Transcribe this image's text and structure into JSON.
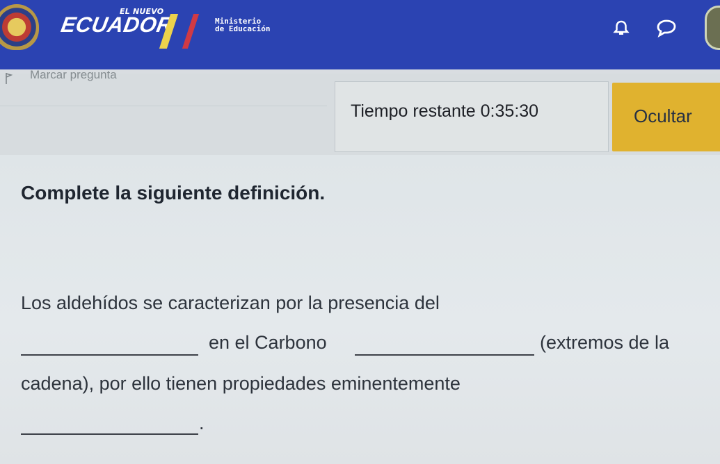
{
  "header": {
    "brand_small": "EL NUEVO",
    "brand_name": "ECUADOR",
    "ministry_line1": "Ministerio",
    "ministry_line2": "de Educación",
    "icons": [
      "crest-icon",
      "bell-icon",
      "chat-icon",
      "avatar"
    ],
    "colors": {
      "bar": "#2b43b2",
      "accent_yellow": "#ecd24c",
      "accent_red": "#d13a44"
    }
  },
  "question_bar": {
    "flag_label": "Marcar pregunta",
    "timer_label": "Tiempo restante 0:35:30",
    "hide_button": "Ocultar"
  },
  "question": {
    "title": "Complete la siguiente definición.",
    "line1": "Los aldehídos se caracterizan por la presencia del",
    "line2_middle": "en el Carbono",
    "line2_end": "(extremos de la",
    "line3": "cadena), por ello tienen propiedades eminentemente",
    "line4_end": "."
  }
}
